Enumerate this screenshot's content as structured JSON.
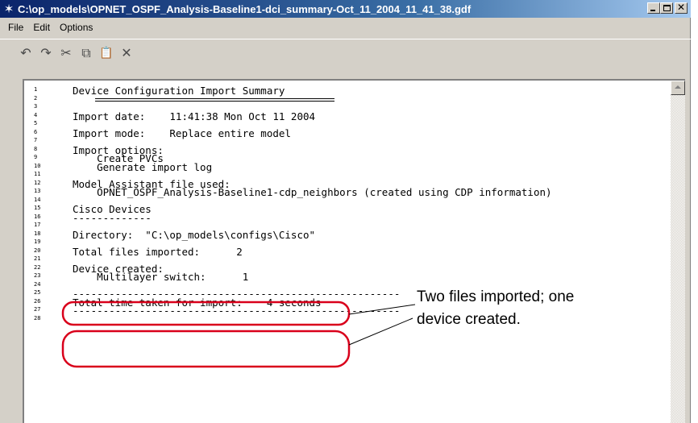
{
  "window": {
    "title": "C:\\op_models\\OPNET_OSPF_Analysis-Baseline1-dci_summary-Oct_11_2004_11_41_38.gdf",
    "icon": "star-app-icon"
  },
  "menu": [
    "File",
    "Edit",
    "Options"
  ],
  "toolbar": [
    {
      "name": "undo-icon",
      "glyph": "↶"
    },
    {
      "name": "redo-icon",
      "glyph": "↷"
    },
    {
      "name": "cut-icon",
      "glyph": "✂"
    },
    {
      "name": "copy-icon",
      "glyph": "⧉"
    },
    {
      "name": "paste-icon",
      "glyph": "📋"
    },
    {
      "name": "delete-icon",
      "glyph": "✕"
    }
  ],
  "lines": [
    "Device Configuration Import Summary",
    "===================================",
    "",
    "Import date:    11:41:38 Mon Oct 11 2004",
    "",
    "Import mode:    Replace entire model",
    "",
    "Import options:",
    "    Create PVCs",
    "    Generate import log",
    "",
    "Model Assistant file used:",
    "    OPNET_OSPF_Analysis-Baseline1-cdp_neighbors (created using CDP information)",
    "",
    "Cisco Devices",
    "-------------",
    "",
    "Directory:  \"C:\\op_models\\configs\\Cisco\"",
    "",
    "Total files imported:      2",
    "",
    "Device created:",
    "    Multilayer switch:      1",
    "",
    "------------------------------------------------------",
    "Total time taken for import:    4 seconds",
    "------------------------------------------------------",
    ""
  ],
  "annotation": {
    "text_line1": "Two files imported; one",
    "text_line2": "device created."
  },
  "colors": {
    "annotation_outline": "#d9001b",
    "titlebar_start": "#0a246a",
    "titlebar_end": "#a6caf0"
  }
}
